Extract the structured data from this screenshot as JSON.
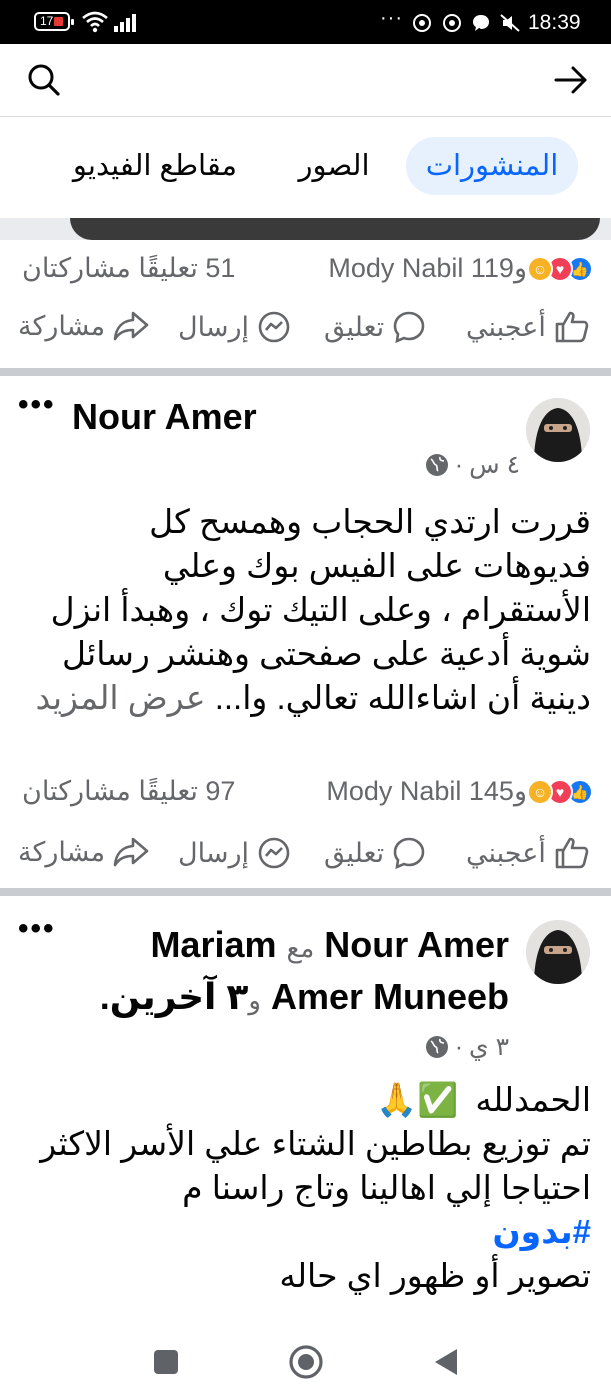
{
  "status_bar": {
    "battery": "17",
    "time": "18:39",
    "dots": "···"
  },
  "search": {
    "icon": "search-icon",
    "back_icon": "arrow-right-icon"
  },
  "tabs": [
    {
      "label": "المنشورات",
      "active": true
    },
    {
      "label": "الصور",
      "active": false
    },
    {
      "label": "مقاطع الفيديو",
      "active": false
    }
  ],
  "post0": {
    "reactions_text": "Mody Nabil و119",
    "stats": "51 تعليقًا مشاركتان"
  },
  "actions": {
    "like": "أعجبني",
    "comment": "تعليق",
    "send": "إرسال",
    "share": "مشاركة"
  },
  "post1": {
    "author": "Nour Amer",
    "time": "٤ س",
    "body_lines": [
      "قررت ارتدي الحجاب  وهمسح كل",
      "فديوهات على الفيس بوك وعلي",
      "الأستقرام ، وعلى التيك توك ، وهبدأ انزل",
      "شوية أدعية على صفحتى وهنشر رسائل"
    ],
    "body_last": "دينية أن اشاءالله تعالي. وا...",
    "see_more": "عرض المزيد",
    "reactions_text": "Mody Nabil و145",
    "stats": "97 تعليقًا مشاركتان"
  },
  "post2": {
    "author": "Nour Amer",
    "with_word": "مع",
    "tagged": "Mariam",
    "tagged2": "Amer Muneeb",
    "and_word": "و",
    "others": "٣ آخرين",
    "time": "٣ ي",
    "line1": "الحمدلله",
    "line1_emojis": "✅🙏",
    "line2": "تم توزيع بطاطين الشتاء علي الأسر الاكثر",
    "line3": "احتياجا إلي اهالينا وتاج راسنا م",
    "hashtag": "#بدون",
    "line4": "تصوير أو ظهور اي حاله"
  },
  "colors": {
    "accent": "#0866ff",
    "tab_active_bg": "#e7f0fd",
    "secondary_text": "#65676b"
  }
}
